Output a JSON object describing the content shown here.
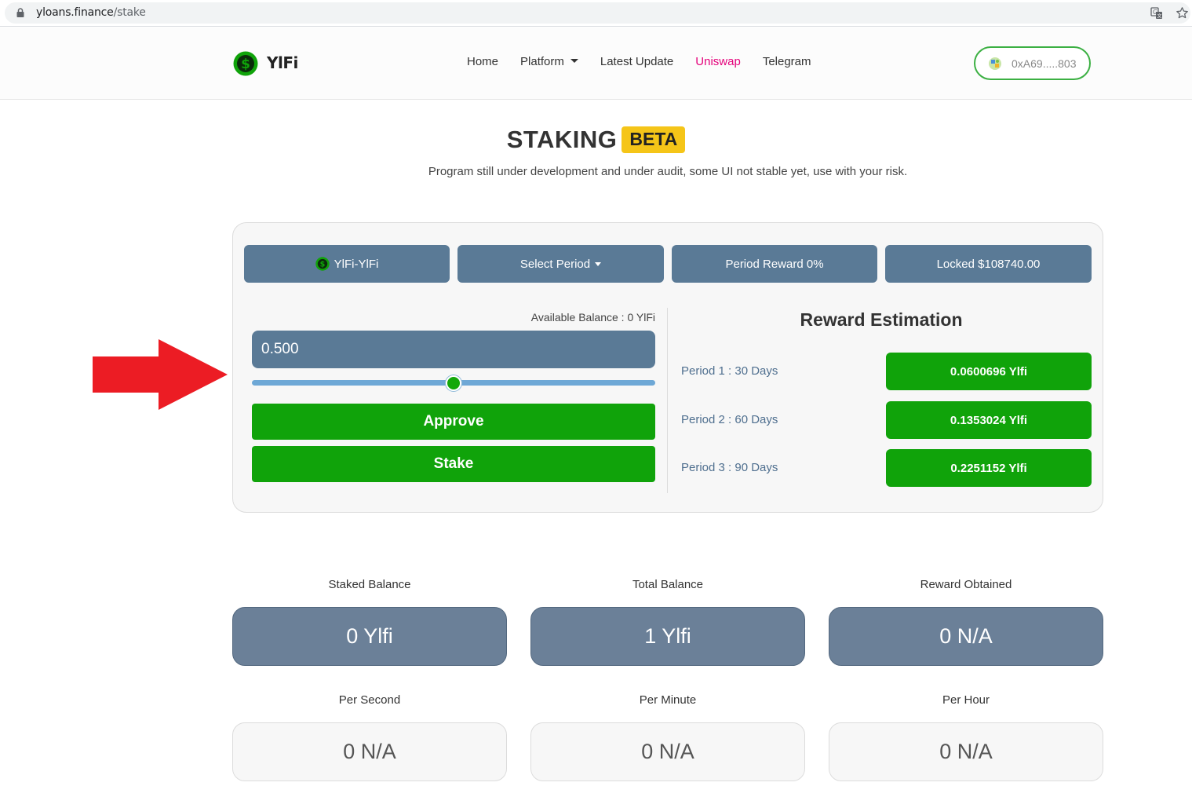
{
  "browser": {
    "url_host": "yloans.finance",
    "url_path": "/stake"
  },
  "nav": {
    "brand": "YlFi",
    "links": [
      "Home",
      "Platform",
      "Latest Update",
      "Uniswap",
      "Telegram"
    ],
    "wallet": "0xA69.....803"
  },
  "header": {
    "title": "STAKING",
    "badge": "BETA",
    "subtitle": "Program still under development and under audit, some UI not stable yet, use with your risk."
  },
  "stake": {
    "pair_label": "YlFi-YlFi",
    "period_select": "Select Period",
    "period_reward": "Period Reward 0%",
    "locked": "Locked $108740.00",
    "available_balance": "Available Balance : 0 YlFi",
    "amount": "0.500",
    "slider_fraction": 0.5,
    "approve_label": "Approve",
    "stake_label": "Stake"
  },
  "reward": {
    "title": "Reward Estimation",
    "periods": [
      {
        "label": "Period 1 : 30 Days",
        "value": "0.0600696 Ylfi"
      },
      {
        "label": "Period 2 : 60 Days",
        "value": "0.1353024 Ylfi"
      },
      {
        "label": "Period 3 : 90 Days",
        "value": "0.2251152 Ylfi"
      }
    ]
  },
  "stats": {
    "primary": [
      {
        "label": "Staked Balance",
        "value": "0 Ylfi"
      },
      {
        "label": "Total Balance",
        "value": "1 Ylfi"
      },
      {
        "label": "Reward Obtained",
        "value": "0 N/A"
      }
    ],
    "secondary": [
      {
        "label": "Per Second",
        "value": "0 N/A"
      },
      {
        "label": "Per Minute",
        "value": "0 N/A"
      },
      {
        "label": "Per Hour",
        "value": "0 N/A"
      }
    ]
  },
  "colors": {
    "accent_green": "#10a30a",
    "slate": "#5a7a96",
    "badge_yellow": "#f5c518",
    "uniswap_pink": "#e4007a",
    "arrow_red": "#ec1c24"
  },
  "icons": [
    "lock-icon",
    "translate-icon",
    "star-icon",
    "logo-icon",
    "wallet-icon",
    "token-icon",
    "chevron-down-icon",
    "red-arrow-icon"
  ]
}
